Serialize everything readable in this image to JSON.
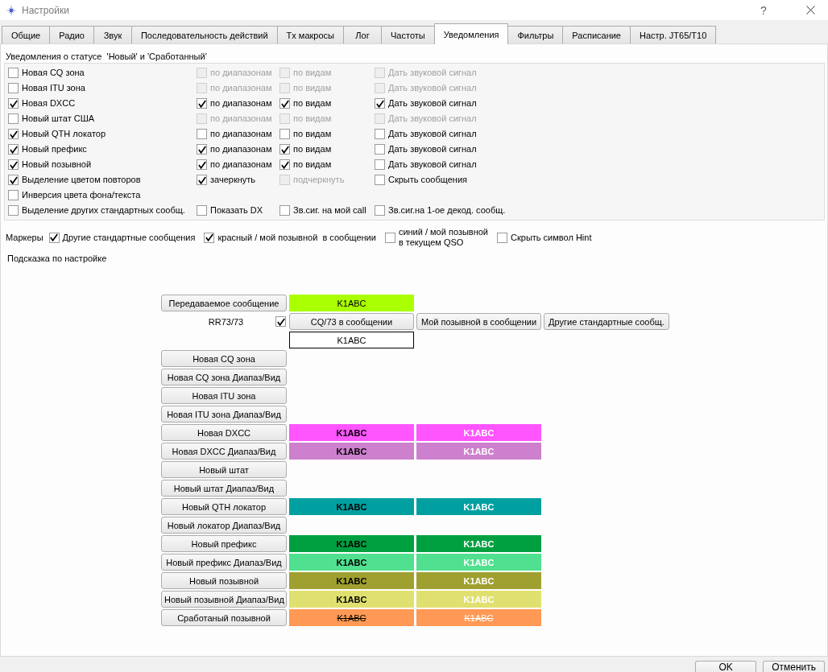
{
  "window": {
    "title": "Настройки",
    "help": "?"
  },
  "tabs": [
    {
      "label": "Общие",
      "selected": false
    },
    {
      "label": "Радио",
      "selected": false
    },
    {
      "label": "Звук",
      "selected": false
    },
    {
      "label": "Последовательность действий",
      "selected": false
    },
    {
      "label": "Tx макросы",
      "selected": false
    },
    {
      "label": "Лог",
      "selected": false
    },
    {
      "label": "Частоты",
      "selected": false
    },
    {
      "label": "Уведомления",
      "selected": true
    },
    {
      "label": "Фильтры",
      "selected": false
    },
    {
      "label": "Расписание",
      "selected": false
    },
    {
      "label": "Настр. JT65/T10",
      "selected": false
    }
  ],
  "status_group": {
    "title": "Уведомления о статусе  'Новый' и 'Сработанный'",
    "rows": [
      {
        "cells": [
          {
            "label": "Новая CQ зона",
            "checked": false,
            "disabled": false
          },
          {
            "label": "по диапазонам",
            "checked": false,
            "disabled": true
          },
          {
            "label": "по видам",
            "checked": false,
            "disabled": true
          },
          {
            "label": "Дать звуковой сигнал",
            "checked": false,
            "disabled": true
          }
        ]
      },
      {
        "cells": [
          {
            "label": "Новая ITU зона",
            "checked": false,
            "disabled": false
          },
          {
            "label": "по диапазонам",
            "checked": false,
            "disabled": true
          },
          {
            "label": "по видам",
            "checked": false,
            "disabled": true
          },
          {
            "label": "Дать звуковой сигнал",
            "checked": false,
            "disabled": true
          }
        ]
      },
      {
        "cells": [
          {
            "label": "Новая DXCC",
            "checked": true,
            "disabled": false
          },
          {
            "label": "по диапазонам",
            "checked": true,
            "disabled": false
          },
          {
            "label": "по видам",
            "checked": true,
            "disabled": false
          },
          {
            "label": "Дать звуковой сигнал",
            "checked": true,
            "disabled": false
          }
        ]
      },
      {
        "cells": [
          {
            "label": "Новый штат США",
            "checked": false,
            "disabled": false
          },
          {
            "label": "по диапазонам",
            "checked": false,
            "disabled": true
          },
          {
            "label": "по видам",
            "checked": false,
            "disabled": true
          },
          {
            "label": "Дать звуковой сигнал",
            "checked": false,
            "disabled": true
          }
        ]
      },
      {
        "cells": [
          {
            "label": "Новый QTH локатор",
            "checked": true,
            "disabled": false
          },
          {
            "label": "по диапазонам",
            "checked": false,
            "disabled": false
          },
          {
            "label": "по видам",
            "checked": false,
            "disabled": false
          },
          {
            "label": "Дать звуковой сигнал",
            "checked": false,
            "disabled": false
          }
        ]
      },
      {
        "cells": [
          {
            "label": "Новый префикс",
            "checked": true,
            "disabled": false
          },
          {
            "label": "по диапазонам",
            "checked": true,
            "disabled": false
          },
          {
            "label": "по видам",
            "checked": true,
            "disabled": false
          },
          {
            "label": "Дать звуковой сигнал",
            "checked": false,
            "disabled": false
          }
        ]
      },
      {
        "cells": [
          {
            "label": "Новый позывной",
            "checked": true,
            "disabled": false
          },
          {
            "label": "по диапазонам",
            "checked": true,
            "disabled": false
          },
          {
            "label": "по видам",
            "checked": true,
            "disabled": false
          },
          {
            "label": "Дать звуковой сигнал",
            "checked": false,
            "disabled": false
          }
        ]
      },
      {
        "cells": [
          {
            "label": "Выделение цветом повторов",
            "checked": true,
            "disabled": false
          },
          {
            "label": "зачеркнуть",
            "checked": true,
            "disabled": false
          },
          {
            "label": "подчеркнуть",
            "checked": false,
            "disabled": true
          },
          {
            "label": "Скрыть сообщения",
            "checked": false,
            "disabled": false
          }
        ]
      },
      {
        "cells": [
          {
            "label": "Инверсия цвета фона/текста",
            "checked": false,
            "disabled": false
          }
        ]
      },
      {
        "cells": [
          {
            "label": "Выделение других стандартных сообщ.",
            "checked": false,
            "disabled": false
          },
          {
            "label": "Показать DX",
            "checked": false,
            "disabled": false
          },
          {
            "label": "Зв.сиг. на мой call",
            "checked": false,
            "disabled": false
          },
          {
            "label": "Зв.сиг.на 1-ое декод. сообщ.",
            "checked": false,
            "disabled": false
          }
        ]
      }
    ]
  },
  "markers": {
    "label": "Маркеры",
    "options": [
      {
        "label": "Другие стандартные сообщения",
        "checked": true
      },
      {
        "label": "красный / мой позывной  в сообщении",
        "checked": true
      },
      {
        "label": "синий / мой позывной\nв текущем QSO",
        "checked": false
      },
      {
        "label": "Скрыть символ Hint",
        "checked": false
      }
    ]
  },
  "hint": "Подсказка по настройке",
  "preview": {
    "tx": {
      "button": "Передаваемое сообщение",
      "sample": {
        "text": "K1ABC",
        "color": "#aaff00"
      }
    },
    "rr73": {
      "label": "RR73/73",
      "checked": true,
      "buttons": [
        "CQ/73 в сообщении",
        "Мой позывной в сообщении",
        "Другие стандартные сообщ."
      ]
    },
    "plain_sample": "K1ABC",
    "rows": [
      {
        "button": "Новая CQ зона"
      },
      {
        "button": "Новая CQ зона Диапаз/Вид"
      },
      {
        "button": "Новая ITU зона"
      },
      {
        "button": "Новая ITU зона Диапаз/Вид"
      },
      {
        "button": "Новая DXCC",
        "samples": [
          {
            "text": "K1ABC",
            "color": "#ff55ff",
            "kind": "dark",
            "struck": false
          },
          {
            "text": "K1ABC",
            "color": "#ff55ff",
            "kind": "light",
            "struck": false
          }
        ]
      },
      {
        "button": "Новая DXCC Диапаз/Вид",
        "samples": [
          {
            "text": "K1ABC",
            "color": "#cd80cd",
            "kind": "dark",
            "struck": false
          },
          {
            "text": "K1ABC",
            "color": "#cd80cd",
            "kind": "light",
            "struck": false
          }
        ]
      },
      {
        "button": "Новый штат"
      },
      {
        "button": "Новый штат Диапаз/Вид"
      },
      {
        "button": "Новый QTH локатор",
        "samples": [
          {
            "text": "K1ABC",
            "color": "#00a0a0",
            "kind": "dark",
            "struck": false
          },
          {
            "text": "K1ABC",
            "color": "#00a0a0",
            "kind": "light",
            "struck": false
          }
        ]
      },
      {
        "button": "Новый локатор Диапаз/Вид"
      },
      {
        "button": "Новый префикс",
        "samples": [
          {
            "text": "K1ABC",
            "color": "#00a040",
            "kind": "dark",
            "struck": false
          },
          {
            "text": "K1ABC",
            "color": "#00a040",
            "kind": "light",
            "struck": false
          }
        ]
      },
      {
        "button": "Новый префикс Диапаз/Вид",
        "samples": [
          {
            "text": "K1ABC",
            "color": "#50e090",
            "kind": "dark",
            "struck": false
          },
          {
            "text": "K1ABC",
            "color": "#50e090",
            "kind": "light",
            "struck": false
          }
        ]
      },
      {
        "button": "Новый позывной",
        "samples": [
          {
            "text": "K1ABC",
            "color": "#a0a030",
            "kind": "dark",
            "struck": false
          },
          {
            "text": "K1ABC",
            "color": "#a0a030",
            "kind": "light",
            "struck": false
          }
        ]
      },
      {
        "button": "Новый позывной Диапаз/Вид",
        "samples": [
          {
            "text": "K1ABC",
            "color": "#e0e070",
            "kind": "dark",
            "struck": false
          },
          {
            "text": "K1ABC",
            "color": "#e0e070",
            "kind": "light",
            "struck": false
          }
        ]
      },
      {
        "button": "Сработаный позывной",
        "samples": [
          {
            "text": "K1ABC",
            "color": "#ff9955",
            "kind": "dark",
            "struck": true
          },
          {
            "text": "K1ABC",
            "color": "#ff9955",
            "kind": "light",
            "struck": true
          }
        ]
      }
    ]
  },
  "buttons": [
    {
      "label": "OK"
    },
    {
      "label": "Отменить"
    }
  ]
}
